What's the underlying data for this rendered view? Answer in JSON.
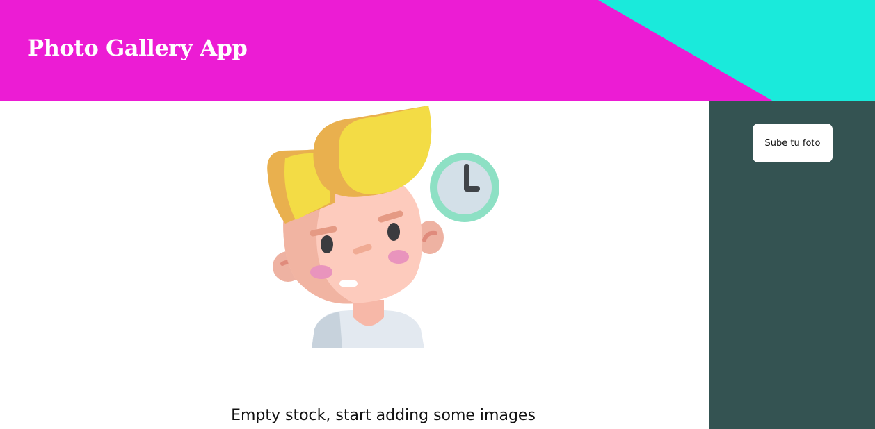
{
  "header": {
    "title": "Photo Gallery App",
    "background_color": "#ec1cd4",
    "accent_color": "#1aeadb"
  },
  "main": {
    "illustration_icon": "thinking-boy-clock-icon",
    "empty_message": "Empty stock, start adding some images"
  },
  "sidebar": {
    "background_color": "#345352",
    "upload_button_label": "Sube tu foto"
  }
}
